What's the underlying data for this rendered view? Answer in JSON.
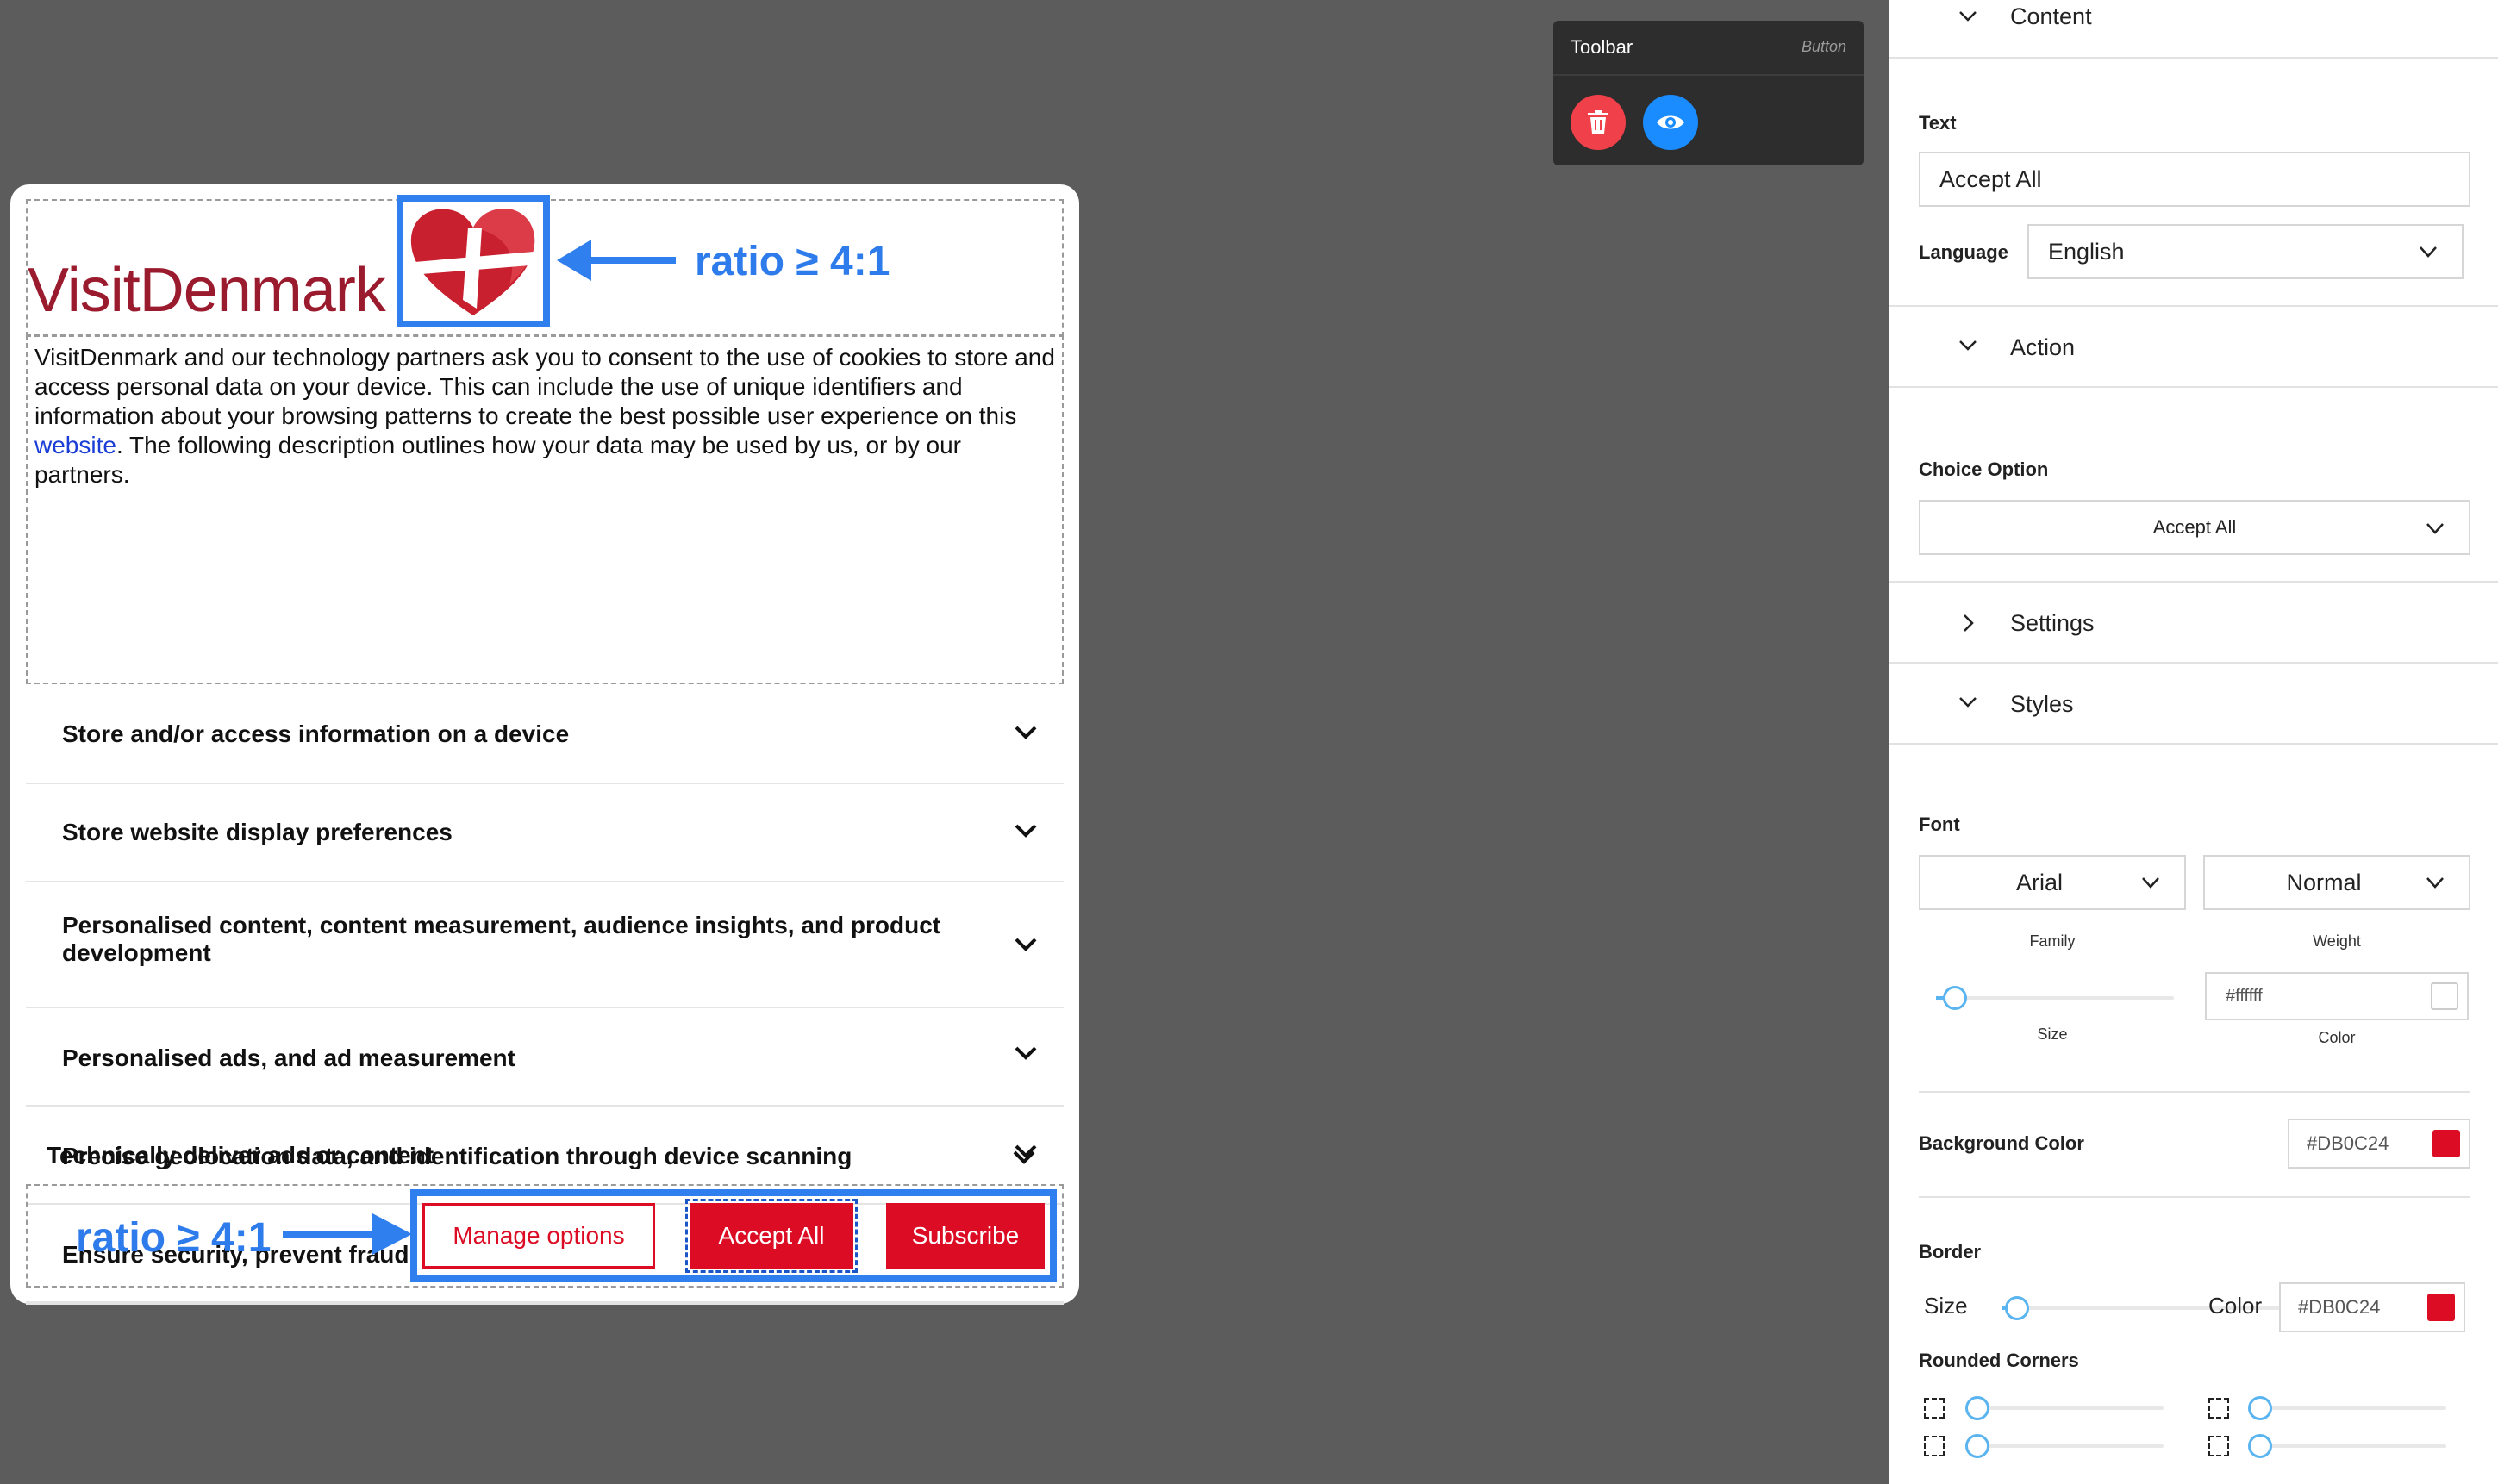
{
  "dialog": {
    "brand_name": "VisitDenmark",
    "annotation_ratio": "ratio ≥ 4:1",
    "description_before_link": "VisitDenmark and our technology partners ask you to consent to the use of cookies to store and access personal data on your device. This can include the use of unique identifiers and information about your browsing patterns to create the best possible user experience on this ",
    "description_link": "website",
    "description_after_link": ". The following description outlines how your data may be used by us, or by our partners.",
    "purposes": [
      "Store and/or access information on a device",
      "Store website display preferences",
      "Personalised content, content measurement, audience insights, and product development",
      "Personalised ads, and ad measurement",
      "Precise geolocation data, and identification through device scanning",
      "Ensure security, prevent fraud, and debug",
      "Technically deliver ads or content"
    ],
    "buttons": {
      "manage": "Manage options",
      "accept": "Accept All",
      "subscribe": "Subscribe"
    }
  },
  "toolbar": {
    "title": "Toolbar",
    "element_type": "Button",
    "delete_icon": "trash-icon",
    "preview_icon": "eye-icon"
  },
  "panel": {
    "sections": {
      "content": "Content",
      "action": "Action",
      "settings": "Settings",
      "styles": "Styles"
    },
    "text_label": "Text",
    "text_value": "Accept All",
    "language_label": "Language",
    "language_value": "English",
    "choice_option_label": "Choice Option",
    "choice_option_value": "Accept All",
    "font_label": "Font",
    "font_family_value": "Arial",
    "font_weight_value": "Normal",
    "family_label": "Family",
    "weight_label": "Weight",
    "size_label": "Size",
    "font_color_value": "#ffffff",
    "color_label": "Color",
    "background_color_label": "Background Color",
    "background_color_value": "#DB0C24",
    "border_label": "Border",
    "border_size_label": "Size",
    "border_color_label": "Color",
    "border_color_value": "#DB0C24",
    "rounded_corners_label": "Rounded Corners"
  },
  "colors": {
    "accent_red": "#DB0C24",
    "highlight_blue": "#2F7FEE",
    "slider_blue": "#5AB4F0"
  }
}
